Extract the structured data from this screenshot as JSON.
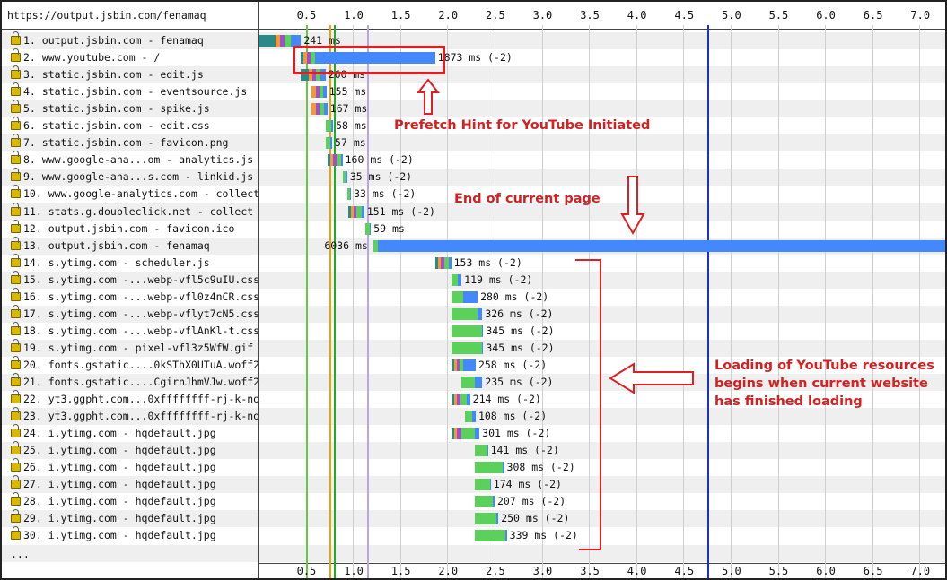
{
  "page_url": "https://output.jsbin.com/fenamaq",
  "axis_ticks": [
    "0.5",
    "1.0",
    "1.5",
    "2.0",
    "2.5",
    "3.0",
    "3.5",
    "4.0",
    "4.5",
    "5.0",
    "5.5",
    "6.0",
    "6.5",
    "7.0"
  ],
  "markers": [
    {
      "time": 0.5,
      "color": "#6cc24a"
    },
    {
      "time": 0.75,
      "color": "#f0a000"
    },
    {
      "time": 0.8,
      "color": "#28a828"
    },
    {
      "time": 1.15,
      "color": "#b9a6e8"
    },
    {
      "time": 4.75,
      "color": "#1a32c8"
    }
  ],
  "requests": [
    {
      "label": "1. output.jsbin.com - fenamaq",
      "start": 0.0,
      "end": 0.45,
      "text": "241 ms",
      "segs": [
        [
          "#2a8a8a",
          0.18
        ],
        [
          "#f29a2e",
          0.05
        ],
        [
          "#a24cd6",
          0.05
        ],
        [
          "#5bd15b",
          0.06
        ],
        [
          "#4488ff",
          0.11
        ]
      ]
    },
    {
      "label": "2. www.youtube.com - /",
      "start": 0.45,
      "end": 1.87,
      "text": "1873 ms (-2)",
      "segs": [
        [
          "#2a8a8a",
          0.03
        ],
        [
          "#f29a2e",
          0.03
        ],
        [
          "#a24cd6",
          0.04
        ],
        [
          "#5bd15b",
          0.05
        ],
        [
          "#4488ff",
          1.27
        ]
      ]
    },
    {
      "label": "3. static.jsbin.com - edit.js",
      "start": 0.45,
      "end": 0.71,
      "text": "260 ms",
      "segs": [
        [
          "#2a8a8a",
          0.08
        ],
        [
          "#f29a2e",
          0.04
        ],
        [
          "#a24cd6",
          0.04
        ],
        [
          "#5bd15b",
          0.05
        ],
        [
          "#4488ff",
          0.05
        ]
      ]
    },
    {
      "label": "4. static.jsbin.com - eventsource.js",
      "start": 0.56,
      "end": 0.72,
      "text": "155 ms",
      "segs": [
        [
          "#f29a2e",
          0.05
        ],
        [
          "#a24cd6",
          0.04
        ],
        [
          "#5bd15b",
          0.03
        ],
        [
          "#4488ff",
          0.04
        ]
      ]
    },
    {
      "label": "5. static.jsbin.com - spike.js",
      "start": 0.56,
      "end": 0.73,
      "text": "167 ms",
      "segs": [
        [
          "#f29a2e",
          0.05
        ],
        [
          "#a24cd6",
          0.04
        ],
        [
          "#5bd15b",
          0.04
        ],
        [
          "#4488ff",
          0.04
        ]
      ]
    },
    {
      "label": "6. static.jsbin.com - edit.css",
      "start": 0.71,
      "end": 0.79,
      "text": "58 ms",
      "segs": [
        [
          "#5bd15b",
          0.06
        ],
        [
          "#4488ff",
          0.02
        ]
      ]
    },
    {
      "label": "7. static.jsbin.com - favicon.png",
      "start": 0.71,
      "end": 0.78,
      "text": "57 ms",
      "segs": [
        [
          "#5bd15b",
          0.05
        ],
        [
          "#4488ff",
          0.02
        ]
      ]
    },
    {
      "label": "8. www.google-ana...om - analytics.js",
      "start": 0.73,
      "end": 0.89,
      "text": "160 ms (-2)",
      "segs": [
        [
          "#2a8a8a",
          0.03
        ],
        [
          "#f29a2e",
          0.03
        ],
        [
          "#a24cd6",
          0.04
        ],
        [
          "#5bd15b",
          0.04
        ],
        [
          "#4488ff",
          0.02
        ]
      ]
    },
    {
      "label": "9. www.google-ana...s.com - linkid.js",
      "start": 0.89,
      "end": 0.94,
      "text": "35 ms (-2)",
      "segs": [
        [
          "#5bd15b",
          0.03
        ],
        [
          "#4488ff",
          0.02
        ]
      ]
    },
    {
      "label": "10. www.google-analytics.com - collect",
      "start": 0.94,
      "end": 0.98,
      "text": "33 ms (-2)",
      "segs": [
        [
          "#5bd15b",
          0.03
        ],
        [
          "#4488ff",
          0.01
        ]
      ]
    },
    {
      "label": "11. stats.g.doubleclick.net - collect",
      "start": 0.95,
      "end": 1.12,
      "text": "151 ms (-2)",
      "segs": [
        [
          "#2a8a8a",
          0.03
        ],
        [
          "#f29a2e",
          0.03
        ],
        [
          "#a24cd6",
          0.03
        ],
        [
          "#5bd15b",
          0.05
        ],
        [
          "#4488ff",
          0.03
        ]
      ]
    },
    {
      "label": "12. output.jsbin.com - favicon.ico",
      "start": 1.13,
      "end": 1.19,
      "text": "59 ms",
      "segs": [
        [
          "#5bd15b",
          0.05
        ],
        [
          "#4488ff",
          0.01
        ]
      ]
    },
    {
      "label": "13. output.jsbin.com - fenamaq",
      "start": 1.22,
      "end": 7.3,
      "text": "6036 ms",
      "segs": [
        [
          "#5bd15b",
          0.04
        ],
        [
          "#4488ff",
          6.04
        ]
      ]
    },
    {
      "label": "14. s.ytimg.com - scheduler.js",
      "start": 1.87,
      "end": 2.04,
      "text": "153 ms (-2)",
      "segs": [
        [
          "#2a8a8a",
          0.03
        ],
        [
          "#f29a2e",
          0.03
        ],
        [
          "#a24cd6",
          0.04
        ],
        [
          "#5bd15b",
          0.05
        ],
        [
          "#4488ff",
          0.02
        ]
      ]
    },
    {
      "label": "15. s.ytimg.com -...webp-vfl5c9uIU.css",
      "start": 2.04,
      "end": 2.15,
      "text": "119 ms (-2)",
      "segs": [
        [
          "#5bd15b",
          0.07
        ],
        [
          "#4488ff",
          0.04
        ]
      ]
    },
    {
      "label": "16. s.ytimg.com -...webp-vfl0z4nCR.css",
      "start": 2.04,
      "end": 2.32,
      "text": "280 ms (-2)",
      "segs": [
        [
          "#5bd15b",
          0.13
        ],
        [
          "#4488ff",
          0.15
        ]
      ]
    },
    {
      "label": "17. s.ytimg.com -...webp-vflyt7cN5.css",
      "start": 2.04,
      "end": 2.37,
      "text": "326 ms (-2)",
      "segs": [
        [
          "#5bd15b",
          0.28
        ],
        [
          "#4488ff",
          0.05
        ]
      ]
    },
    {
      "label": "18. s.ytimg.com -...webp-vflAnKl-t.css",
      "start": 2.04,
      "end": 2.38,
      "text": "345 ms (-2)",
      "segs": [
        [
          "#5bd15b",
          0.33
        ],
        [
          "#4488ff",
          0.01
        ]
      ]
    },
    {
      "label": "19. s.ytimg.com - pixel-vfl3z5WfW.gif",
      "start": 2.04,
      "end": 2.38,
      "text": "345 ms (-2)",
      "segs": [
        [
          "#5bd15b",
          0.33
        ],
        [
          "#4488ff",
          0.01
        ]
      ]
    },
    {
      "label": "20. fonts.gstatic....0kSThX0UTuA.woff2",
      "start": 2.04,
      "end": 2.3,
      "text": "258 ms (-2)",
      "segs": [
        [
          "#2a8a8a",
          0.03
        ],
        [
          "#f29a2e",
          0.03
        ],
        [
          "#a24cd6",
          0.03
        ],
        [
          "#5bd15b",
          0.04
        ],
        [
          "#4488ff",
          0.13
        ]
      ]
    },
    {
      "label": "21. fonts.gstatic....CgirnJhmVJw.woff2",
      "start": 2.15,
      "end": 2.37,
      "text": "235 ms (-2)",
      "segs": [
        [
          "#5bd15b",
          0.14
        ],
        [
          "#4488ff",
          0.08
        ]
      ]
    },
    {
      "label": "22. yt3.ggpht.com...0xffffffff-rj-k-no",
      "start": 2.04,
      "end": 2.24,
      "text": "214 ms (-2)",
      "segs": [
        [
          "#2a8a8a",
          0.03
        ],
        [
          "#f29a2e",
          0.03
        ],
        [
          "#a24cd6",
          0.04
        ],
        [
          "#5bd15b",
          0.07
        ],
        [
          "#4488ff",
          0.03
        ]
      ]
    },
    {
      "label": "23. yt3.ggpht.com...0xffffffff-rj-k-no",
      "start": 2.19,
      "end": 2.3,
      "text": "108 ms (-2)",
      "segs": [
        [
          "#5bd15b",
          0.07
        ],
        [
          "#4488ff",
          0.04
        ]
      ]
    },
    {
      "label": "24. i.ytimg.com - hqdefault.jpg",
      "start": 2.04,
      "end": 2.34,
      "text": "301 ms (-2)",
      "segs": [
        [
          "#2a8a8a",
          0.03
        ],
        [
          "#f29a2e",
          0.03
        ],
        [
          "#a24cd6",
          0.05
        ],
        [
          "#5bd15b",
          0.14
        ],
        [
          "#4488ff",
          0.05
        ]
      ]
    },
    {
      "label": "25. i.ytimg.com - hqdefault.jpg",
      "start": 2.29,
      "end": 2.43,
      "text": "141 ms (-2)",
      "segs": [
        [
          "#5bd15b",
          0.13
        ],
        [
          "#4488ff",
          0.01
        ]
      ]
    },
    {
      "label": "26. i.ytimg.com - hqdefault.jpg",
      "start": 2.29,
      "end": 2.6,
      "text": "308 ms (-2)",
      "segs": [
        [
          "#5bd15b",
          0.3
        ],
        [
          "#4488ff",
          0.01
        ]
      ]
    },
    {
      "label": "27. i.ytimg.com - hqdefault.jpg",
      "start": 2.29,
      "end": 2.46,
      "text": "174 ms (-2)",
      "segs": [
        [
          "#5bd15b",
          0.16
        ],
        [
          "#4488ff",
          0.01
        ]
      ]
    },
    {
      "label": "28. i.ytimg.com - hqdefault.jpg",
      "start": 2.29,
      "end": 2.5,
      "text": "207 ms (-2)",
      "segs": [
        [
          "#5bd15b",
          0.19
        ],
        [
          "#4488ff",
          0.02
        ]
      ]
    },
    {
      "label": "29. i.ytimg.com - hqdefault.jpg",
      "start": 2.29,
      "end": 2.54,
      "text": "250 ms (-2)",
      "segs": [
        [
          "#5bd15b",
          0.23
        ],
        [
          "#4488ff",
          0.02
        ]
      ]
    },
    {
      "label": "30. i.ytimg.com - hqdefault.jpg",
      "start": 2.29,
      "end": 2.63,
      "text": "339 ms (-2)",
      "segs": [
        [
          "#5bd15b",
          0.32
        ],
        [
          "#4488ff",
          0.02
        ]
      ]
    }
  ],
  "more_rows": "...",
  "annotations": {
    "prefetch": "Prefetch Hint for YouTube Initiated",
    "end_page": "End of current page",
    "loading_l1": "Loading of YouTube resources",
    "loading_l2": "begins when current website",
    "loading_l3": "has finished loading"
  },
  "colors": {
    "annotation": "#d42020",
    "row_alt": "#efefef"
  }
}
